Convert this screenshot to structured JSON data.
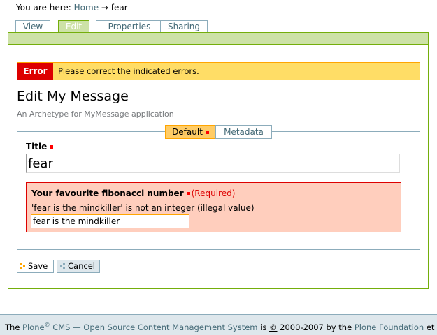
{
  "breadcrumb": {
    "prefix": "You are here:",
    "home": "Home",
    "arrow": "→",
    "current": "fear"
  },
  "tabs": [
    {
      "label": "View"
    },
    {
      "label": "Edit"
    },
    {
      "label": "Properties"
    },
    {
      "label": "Sharing"
    }
  ],
  "error": {
    "label": "Error",
    "message": "Please correct the indicated errors."
  },
  "page": {
    "title": "Edit My Message",
    "description": "An Archetype for MyMessage application"
  },
  "fieldset_tabs": [
    {
      "label": "Default"
    },
    {
      "label": "Metadata"
    }
  ],
  "fields": {
    "title": {
      "label": "Title",
      "value": "fear"
    },
    "fibonacci": {
      "label": "Your favourite fibonacci number",
      "required": "(Required)",
      "error": "'fear is the mindkiller' is not an integer (illegal value)",
      "value": "fear is the mindkiller"
    }
  },
  "buttons": {
    "save": "Save",
    "cancel": "Cancel"
  },
  "footer": {
    "the": "The",
    "plone": "Plone",
    "reg": "®",
    "cms": "CMS — Open Source Content Management System",
    "is": "is",
    "copyright": "©",
    "years": "2000-2007 by the",
    "foundation": "Plone Foundation",
    "et": "et"
  },
  "colors": {
    "accent_green": "#74ae0b",
    "link": "#436976",
    "error_red": "#dd0000",
    "warning_yellow": "#ffdd66"
  }
}
